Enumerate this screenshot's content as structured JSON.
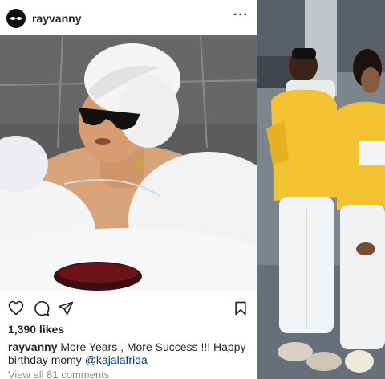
{
  "post": {
    "username": "rayvanny",
    "more_icon": "more-horizontal-icon",
    "actions": {
      "like_icon": "heart-outline-icon",
      "comment_icon": "comment-bubble-icon",
      "share_icon": "paper-plane-icon",
      "save_icon": "bookmark-outline-icon"
    },
    "likes": "1,390 likes",
    "caption": {
      "user": "rayvanny",
      "text": " More Years , More Success !!! Happy birthday momy ",
      "mention": "@kajalafrida"
    },
    "view_comments": "View all 81 comments"
  },
  "colors": {
    "text": "#262626",
    "secondary_text": "#8e8e8e",
    "mention": "#00376b",
    "jacket_yellow": "#f2c230"
  }
}
